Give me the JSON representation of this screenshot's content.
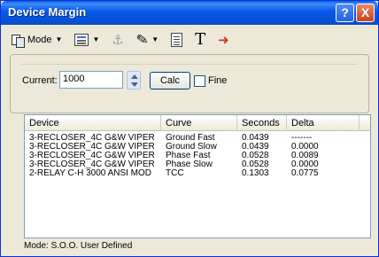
{
  "window": {
    "title": "Device Margin"
  },
  "title_buttons": {
    "help": "?",
    "close": "X"
  },
  "toolbar": {
    "mode_label": "Mode"
  },
  "form": {
    "current_label": "Current:",
    "current_value": "1000",
    "calc_label": "Calc",
    "fine_label": "Fine",
    "fine_checked": false
  },
  "table": {
    "headers": [
      "Device",
      "Curve",
      "Seconds",
      "Delta"
    ],
    "rows": [
      {
        "device": "3-RECLOSER_4C G&W VIPER",
        "curve": "Ground Fast",
        "seconds": "0.0439",
        "delta": "-------"
      },
      {
        "device": "3-RECLOSER_4C G&W VIPER",
        "curve": "Ground Slow",
        "seconds": "0.0439",
        "delta": "0.0000"
      },
      {
        "device": "3-RECLOSER_4C G&W VIPER",
        "curve": "Phase Fast",
        "seconds": "0.0528",
        "delta": "0.0089"
      },
      {
        "device": "3-RECLOSER_4C G&W VIPER",
        "curve": "Phase Slow",
        "seconds": "0.0528",
        "delta": "0.0000"
      },
      {
        "device": "2-RELAY C-H 3000 ANSI MOD",
        "curve": "TCC",
        "seconds": "0.1303",
        "delta": "0.0775"
      }
    ]
  },
  "status": {
    "text": "Mode: S.O.O. User Defined"
  },
  "icons": [
    "mode-icon",
    "properties-icon",
    "anchor-icon",
    "pen-icon",
    "document-icon",
    "font-icon",
    "exit-icon"
  ]
}
